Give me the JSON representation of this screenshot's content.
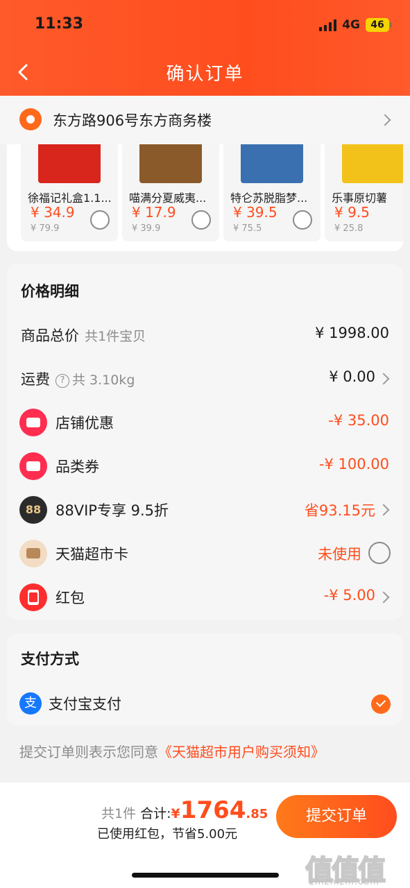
{
  "status_bar": {
    "time": "11:33",
    "network": "4G",
    "battery": "46"
  },
  "header": {
    "title": "确认订单"
  },
  "address": {
    "text": "东方路906号东方商务楼"
  },
  "products": [
    {
      "name": "徐福记礼盒1.1...",
      "price": "¥ 34.9",
      "original": "¥ 79.9",
      "img_color": "#d9261c"
    },
    {
      "name": "喵满分夏威夷...",
      "price": "¥ 17.9",
      "original": "¥ 39.9",
      "img_color": "#8a5a2a"
    },
    {
      "name": "特仑苏脱脂梦...",
      "price": "¥ 39.5",
      "original": "¥ 75.5",
      "img_color": "#3a6fb0"
    },
    {
      "name": "乐事原切薯",
      "price": "¥ 9.5",
      "original": "¥ 25.8",
      "img_color": "#f2c21a"
    }
  ],
  "price_detail": {
    "title": "价格明细",
    "goods_total": {
      "label": "商品总价",
      "sub": "共1件宝贝",
      "value": "¥ 1998.00"
    },
    "shipping": {
      "label": "运费",
      "sub": "共 3.10kg",
      "help": "?",
      "value": "¥ 0.00"
    },
    "shop_discount": {
      "label": "店铺优惠",
      "value": "-¥ 35.00"
    },
    "category_coupon": {
      "label": "品类券",
      "value": "-¥ 100.00"
    },
    "vip": {
      "icon_text": "88",
      "label": "88VIP专享 9.5折",
      "value": "省93.15元"
    },
    "tmall_card": {
      "label": "天猫超市卡",
      "value": "未使用"
    },
    "hongbao": {
      "label": "红包",
      "value": "-¥ 5.00"
    }
  },
  "payment": {
    "title": "支付方式",
    "icon_text": "支",
    "method": "支付宝支付"
  },
  "agreement": {
    "prefix": "提交订单则表示您同意",
    "link": "《天猫超市用户购买须知》"
  },
  "bottom_bar": {
    "count": "共1件",
    "total_label": "合计:",
    "currency": "¥",
    "amount_int": "1764",
    "amount_dec": ".85",
    "saved": "已使用红包，节省5.00元",
    "submit": "提交订单"
  },
  "watermark": {
    "text": "值值值",
    "url": "zhizhizhi.com"
  },
  "colors": {
    "brand": "#ff4d1e",
    "accent_orange": "#ff6a1a",
    "alipay": "#1677ff"
  }
}
